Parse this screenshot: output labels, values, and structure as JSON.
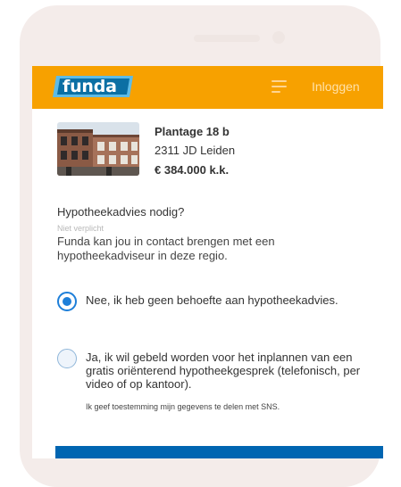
{
  "header": {
    "logo_text": "funda",
    "login_label": "Inloggen"
  },
  "listing": {
    "street": "Plantage 18 b",
    "city": "2311 JD  Leiden",
    "price": "€ 384.000 k.k."
  },
  "question": {
    "title": "Hypotheekadvies nodig?",
    "optional": "Niet verplicht",
    "description": "Funda kan jou in contact brengen met een hypotheekadviseur in deze regio."
  },
  "options": [
    {
      "label": "Nee, ik heb geen behoefte aan hypotheekadvies.",
      "selected": true
    },
    {
      "label": "Ja, ik wil gebeld worden voor het inplannen van een gratis oriënterend hypotheekgesprek (telefonisch, per video of op kantoor).",
      "selected": false
    }
  ],
  "consent_text": "Ik geef toestemming mijn gegevens te delen met SNS.",
  "colors": {
    "brand_orange": "#f7a100",
    "logo_blue": "#5ebbe6",
    "accent_blue": "#1e7fd9",
    "button_blue": "#0065b1"
  },
  "icons": [
    "menu-icon",
    "radio-selected-icon",
    "radio-unselected-icon"
  ]
}
